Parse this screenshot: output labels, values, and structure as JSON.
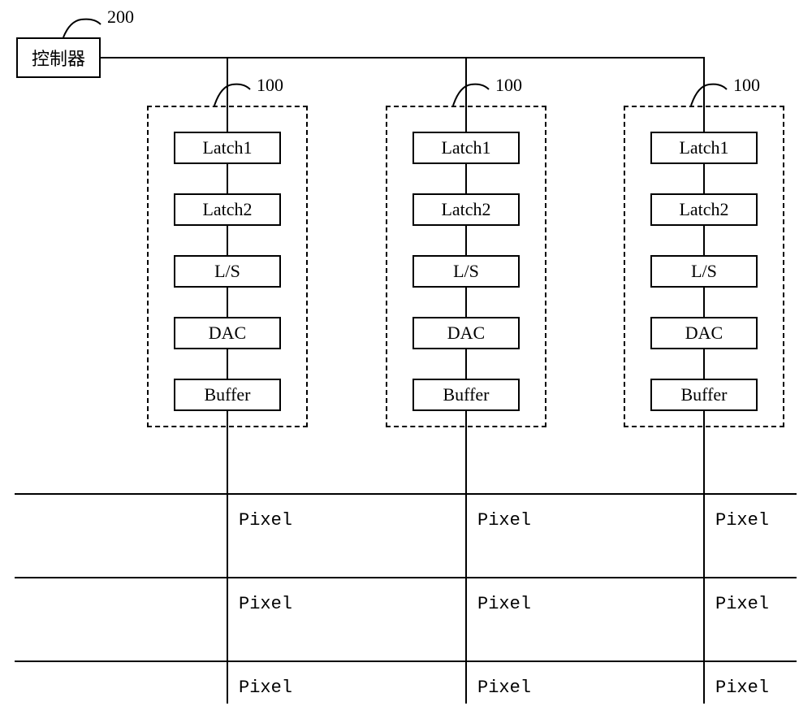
{
  "controller": {
    "label": "控制器",
    "ref": "200"
  },
  "channel_ref": "100",
  "blocks": {
    "latch1": "Latch1",
    "latch2": "Latch2",
    "ls": "L/S",
    "dac": "DAC",
    "buffer": "Buffer"
  },
  "pixel_label": "Pixel"
}
